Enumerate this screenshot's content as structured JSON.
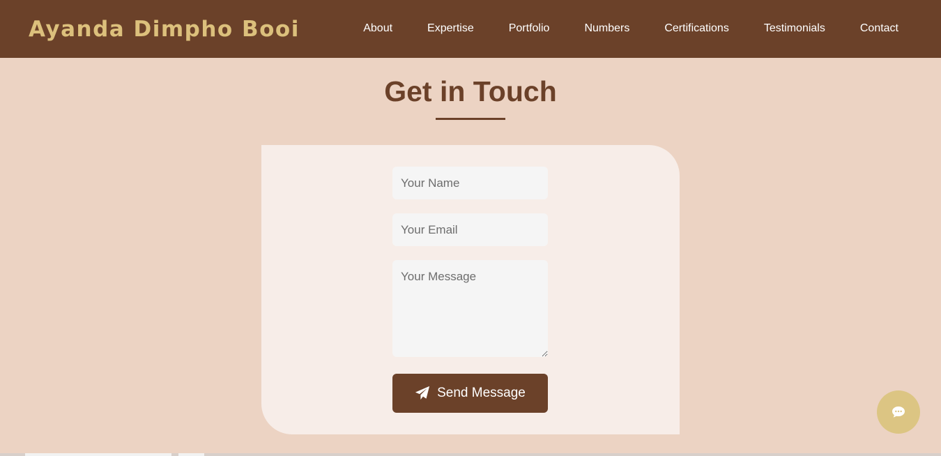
{
  "header": {
    "brand": "Ayanda Dimpho Booi",
    "nav": [
      {
        "label": "About"
      },
      {
        "label": "Expertise"
      },
      {
        "label": "Portfolio"
      },
      {
        "label": "Numbers"
      },
      {
        "label": "Certifications"
      },
      {
        "label": "Testimonials"
      },
      {
        "label": "Contact"
      }
    ]
  },
  "contact": {
    "title": "Get in Touch",
    "name_placeholder": "Your Name",
    "email_placeholder": "Your Email",
    "message_placeholder": "Your Message",
    "submit_label": "Send Message",
    "submit_icon": "paper-plane-icon"
  },
  "chat": {
    "icon": "chat-bubble-icon"
  },
  "colors": {
    "primary": "#6b4129",
    "accent": "#dcc07c",
    "background": "#ecd3c3",
    "card": "#f7ede8"
  }
}
